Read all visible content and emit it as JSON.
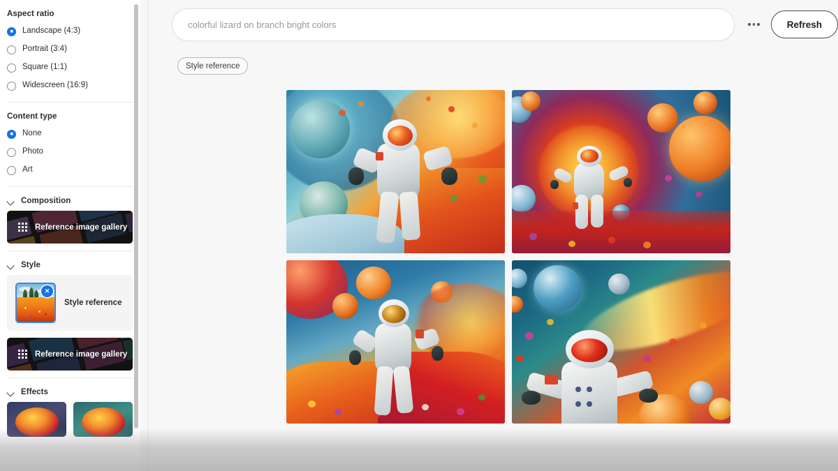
{
  "sidebar": {
    "aspect_ratio": {
      "title": "Aspect ratio",
      "options": [
        {
          "label": "Landscape (4:3)",
          "selected": true
        },
        {
          "label": "Portrait (3:4)",
          "selected": false
        },
        {
          "label": "Square (1:1)",
          "selected": false
        },
        {
          "label": "Widescreen (16:9)",
          "selected": false
        }
      ]
    },
    "content_type": {
      "title": "Content type",
      "options": [
        {
          "label": "None",
          "selected": true
        },
        {
          "label": "Photo",
          "selected": false
        },
        {
          "label": "Art",
          "selected": false
        }
      ]
    },
    "composition": {
      "title": "Composition",
      "gallery_label": "Reference image gallery"
    },
    "style": {
      "title": "Style",
      "reference_label": "Style reference",
      "remove_label": "✕",
      "gallery_label": "Reference image gallery"
    },
    "effects": {
      "title": "Effects"
    }
  },
  "main": {
    "prompt": {
      "value": "colorful lizard on branch bright colors",
      "placeholder": "colorful lizard on branch bright colors"
    },
    "more_options_label": "",
    "refresh_label": "Refresh",
    "chips": [
      {
        "label": "Style reference"
      }
    ],
    "results": [
      {
        "alt": "Astronaut walking on colorful flower planet with moons"
      },
      {
        "alt": "Astronaut floating in swirling flower galaxy with orange planet"
      },
      {
        "alt": "Astronaut in red flower field with red and orange planets"
      },
      {
        "alt": "Astronaut close-up before flower galaxy spiral"
      }
    ]
  },
  "colors": {
    "accent": "#1473e6",
    "sidebar_bg": "#ffffff",
    "main_bg": "#f7f7f7",
    "text": "#2c2c2c"
  }
}
